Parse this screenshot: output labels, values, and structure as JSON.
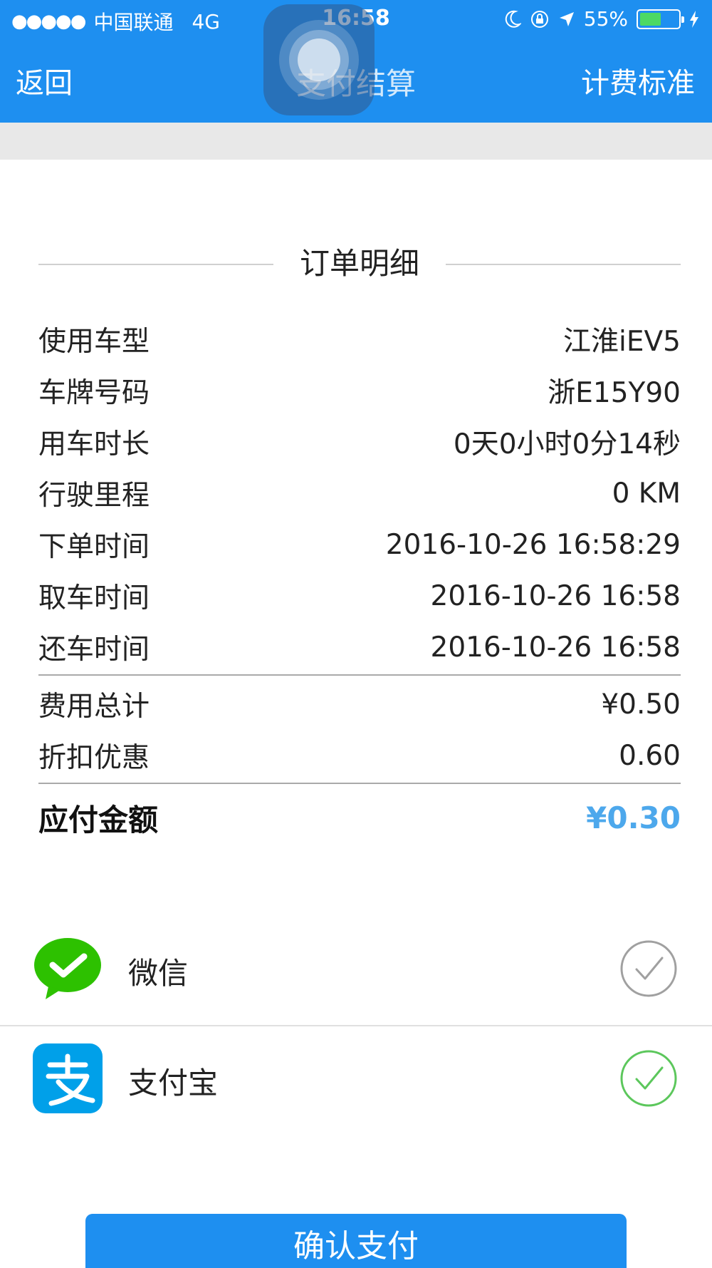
{
  "status_bar": {
    "signal": "●●●●●",
    "carrier": "中国联通",
    "network": "4G",
    "time": "16:58",
    "battery": "55%",
    "battery_level": 0.55
  },
  "nav": {
    "back_label": "返回",
    "title": "支付结算",
    "right_label": "计费标准"
  },
  "order": {
    "section_title": "订单明细",
    "details": [
      {
        "label": "使用车型",
        "value": "江淮iEV5"
      },
      {
        "label": "车牌号码",
        "value": "浙E15Y90"
      },
      {
        "label": "用车时长",
        "value": "0天0小时0分14秒"
      },
      {
        "label": "行驶里程",
        "value": "0 KM"
      },
      {
        "label": "下单时间",
        "value": "2016-10-26 16:58:29"
      },
      {
        "label": "取车时间",
        "value": "2016-10-26 16:58"
      },
      {
        "label": "还车时间",
        "value": "2016-10-26 16:58"
      }
    ],
    "fees": [
      {
        "label": "费用总计",
        "value": "¥0.50"
      },
      {
        "label": "折扣优惠",
        "value": "0.60"
      }
    ],
    "total": {
      "label": "应付金额",
      "value": "¥0.30"
    }
  },
  "payment": {
    "methods": [
      {
        "name": "微信",
        "icon": "wechat-icon",
        "selected": false,
        "check_color": "#a0a0a0"
      },
      {
        "name": "支付宝",
        "icon": "alipay-icon",
        "selected": true,
        "check_color": "#5cc75c"
      }
    ]
  },
  "confirm_label": "确认支付",
  "colors": {
    "primary": "#1e8ff0",
    "total_amount": "#4da8ec",
    "wechat": "#2dc100",
    "alipay": "#00a0e9"
  }
}
